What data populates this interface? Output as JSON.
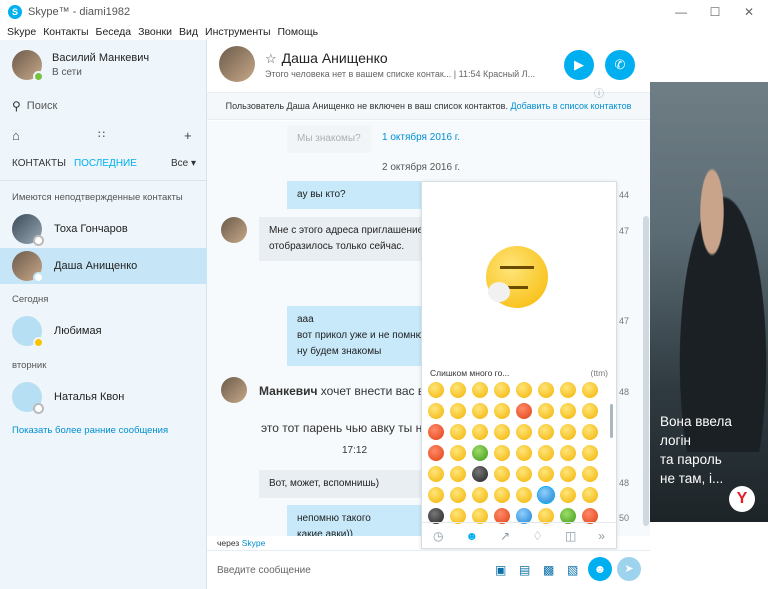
{
  "window": {
    "title": "Skype™ - diami1982",
    "minimize": "—",
    "maximize": "☐",
    "close": "✕"
  },
  "menu": [
    "Skype",
    "Контакты",
    "Беседа",
    "Звонки",
    "Вид",
    "Инструменты",
    "Помощь"
  ],
  "profile": {
    "name": "Василий Манкевич",
    "status": "В сети"
  },
  "search": {
    "placeholder": "Поиск"
  },
  "tabs": {
    "contacts": "КОНТАКТЫ",
    "recent": "ПОСЛЕДНИЕ",
    "filter": "Все"
  },
  "sidebar": {
    "unconfirmed_label": "Имеются неподтвержденные контакты",
    "today_label": "Сегодня",
    "tuesday_label": "вторник",
    "more_link": "Показать более ранние сообщения",
    "contacts": [
      {
        "name": "Тоха Гончаров"
      },
      {
        "name": "Даша Анищенко"
      },
      {
        "name": "Любимая"
      },
      {
        "name": "Наталья Квон"
      }
    ]
  },
  "chat": {
    "name": "Даша Анищенко",
    "subtitle": "Этого человека нет в вашем списке контак... | 11:54 Красный Л...",
    "banner_text": "Пользователь Даша Анищенко не включен в ваш список контактов.",
    "banner_link": "Добавить в список контактов",
    "date1": "1 октября 2016 г.",
    "date2": "2 октября 2016 г.",
    "ghost1": "Мы знакомы?",
    "msg1": "ау вы кто?",
    "time1": "44",
    "msg2_line1": "Мне с этого адреса приглашение",
    "msg2_line2": "отобразилось только сейчас.",
    "time2": "47",
    "msg3_line1": "ааа",
    "msg3_line2": "вот прикол уже и не помню",
    "msg3_line3": "ну будем знакомы",
    "time3": "47",
    "msg4_name": "Манкевич",
    "msg4_text": " хочет внести вас в",
    "time4": "48",
    "msg5": "это тот парень чью авку ты не",
    "time5": "17:12",
    "msg6": "Вот, может, вспомнишь)",
    "time6": "48",
    "msg7_line1": "непомню такого",
    "msg7_line2": "какие авки))",
    "time7": "50",
    "via_prefix": "через ",
    "via_link": "Skype",
    "input_placeholder": "Введите сообщение"
  },
  "emoji_panel": {
    "name": "Слишком много го...",
    "code": "(ttm)"
  },
  "ad": {
    "line1": "Вона ввела",
    "line2": "логін",
    "line3": "та пароль",
    "line4": "не там, і...",
    "logo": "Y"
  },
  "colors": {
    "accent": "#00aff0",
    "sidebar_bg": "#eef6fb",
    "selected": "#c6e6f7",
    "bubble_out": "#c7e9fa"
  }
}
